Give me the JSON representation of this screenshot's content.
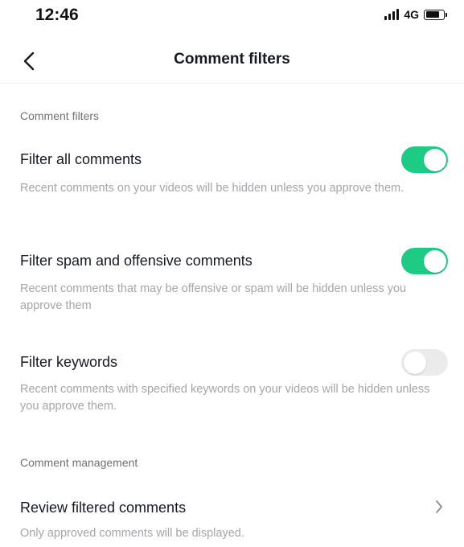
{
  "status_bar": {
    "time": "12:46",
    "network": "4G"
  },
  "nav": {
    "title": "Comment filters",
    "back_icon": "chevron-left-icon"
  },
  "filters_section": {
    "header": "Comment filters",
    "items": [
      {
        "title": "Filter all comments",
        "description": "Recent comments on your videos will be hidden unless you approve them.",
        "enabled": true
      },
      {
        "title": "Filter spam and offensive comments",
        "description": "Recent comments that may be offensive or spam will be hidden unless you approve them",
        "enabled": true
      },
      {
        "title": "Filter keywords",
        "description": "Recent comments with specified keywords on your videos will be hidden unless you approve them.",
        "enabled": false
      }
    ]
  },
  "management_section": {
    "header": "Comment management",
    "review": {
      "title": "Review filtered comments",
      "description": "Only approved comments will be displayed.",
      "icon": "chevron-right-icon"
    }
  },
  "colors": {
    "toggle_on": "#1fcb84",
    "toggle_off": "#ebebeb",
    "secondary_text": "#a4a5a9"
  }
}
